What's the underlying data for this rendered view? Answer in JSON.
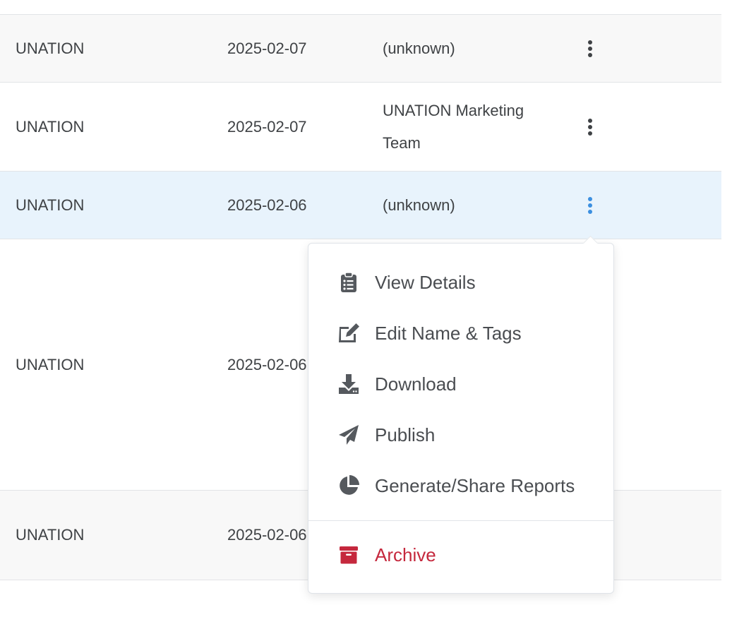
{
  "rows": [
    {
      "owner": "UNATION",
      "date": "2025-02-07",
      "creator": "(unknown)"
    },
    {
      "owner": "UNATION",
      "date": "2025-02-07",
      "creator": "UNATION Marketing Team"
    },
    {
      "owner": "UNATION",
      "date": "2025-02-06",
      "creator": "(unknown)"
    },
    {
      "owner": "UNATION",
      "date": "2025-02-06",
      "creator": ""
    },
    {
      "owner": "UNATION",
      "date": "2025-02-06",
      "creator": ""
    }
  ],
  "menu": {
    "items": [
      {
        "label": "View Details",
        "icon": "clipboard-list-icon"
      },
      {
        "label": "Edit Name & Tags",
        "icon": "edit-icon"
      },
      {
        "label": "Download",
        "icon": "download-icon"
      },
      {
        "label": "Publish",
        "icon": "paper-plane-icon"
      },
      {
        "label": "Generate/Share Reports",
        "icon": "pie-chart-icon"
      }
    ],
    "archive": {
      "label": "Archive",
      "icon": "archive-icon"
    }
  },
  "colors": {
    "kebab_default": "#3f4245",
    "kebab_active": "#3b8fe0",
    "selected_row": "#e8f3fc",
    "danger": "#c5283d",
    "icon": "#55595e"
  }
}
